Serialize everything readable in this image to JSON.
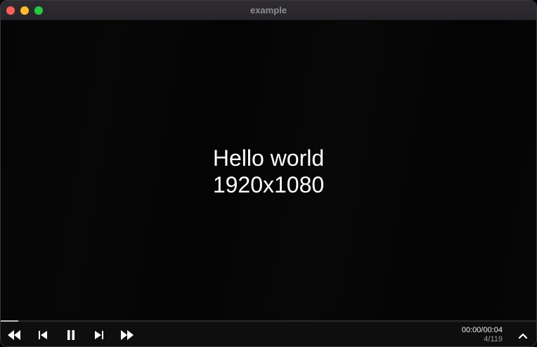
{
  "window": {
    "title": "example"
  },
  "video": {
    "line1": "Hello world",
    "line2": "1920x1080"
  },
  "player": {
    "progress_fraction": 0.033,
    "time": "00:00/00:04",
    "frame": "4/119",
    "icons": {
      "rewind": "rewind-icon",
      "previous": "skip-previous-icon",
      "pause": "pause-icon",
      "next": "skip-next-icon",
      "fast_forward": "fast-forward-icon",
      "expand": "chevron-up-icon"
    }
  },
  "colors": {
    "close": "#ff5f57",
    "minimize": "#febc2e",
    "maximize": "#28c840",
    "progress": "#bdbdbd"
  }
}
